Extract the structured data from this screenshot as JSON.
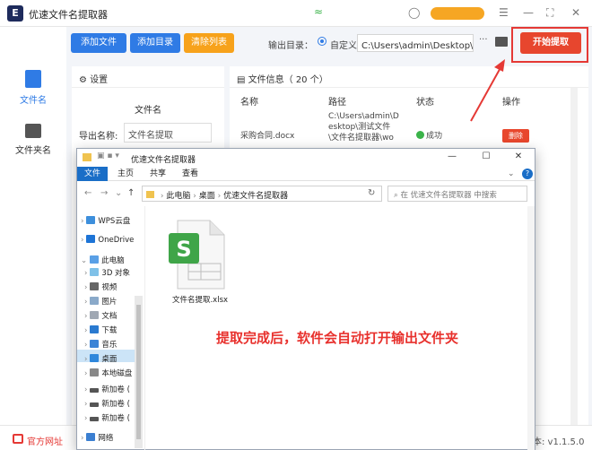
{
  "app": {
    "title": "优速文件名提取器",
    "logo": "E"
  },
  "sidebar": {
    "items": [
      {
        "label": "文件名",
        "icon": "file-icon",
        "color": "#2f7be5"
      },
      {
        "label": "文件夹名",
        "icon": "folder-icon",
        "color": "#555555"
      }
    ]
  },
  "toolbar": {
    "add_file": "添加文件",
    "add_dir": "添加目录",
    "clear_list": "清除列表",
    "output_label": "输出目录：",
    "custom_label": "自定义",
    "output_path": "C:\\Users\\admin\\Desktop\\优速",
    "more": "···",
    "start": "开始提取"
  },
  "settings": {
    "header": "设置",
    "column_title": "文件名",
    "export_label": "导出名称:",
    "export_value": "文件名提取"
  },
  "file_info": {
    "header": "文件信息（ 20 个）",
    "columns": [
      "名称",
      "路径",
      "状态",
      "操作"
    ],
    "row": {
      "name": "采购合同.docx",
      "path_lines": [
        "C:\\Users\\admin\\D",
        "esktop\\测试文件",
        "\\文件名提取器\\wo"
      ],
      "status": "成功",
      "action": "删除"
    }
  },
  "statusbar": {
    "home": "官方网址",
    "version": "本: v1.1.5.0"
  },
  "explorer": {
    "title": "优速文件名提取器",
    "tabs": [
      "文件",
      "主页",
      "共享",
      "查看"
    ],
    "breadcrumb": [
      "此电脑",
      "桌面",
      "优速文件名提取器"
    ],
    "search_placeholder": "在 优速文件名提取器 中搜索",
    "tree": [
      "WPS云盘",
      "OneDrive",
      "此电脑",
      "3D 对象",
      "视频",
      "图片",
      "文档",
      "下载",
      "音乐",
      "桌面",
      "本地磁盘",
      "新加卷 (",
      "新加卷 (",
      "新加卷 (",
      "网络"
    ],
    "file": {
      "name": "文件名提取.xlsx",
      "icon": "spreadsheet-icon",
      "badge": "S"
    }
  },
  "annotation": "提取完成后，软件会自动打开输出文件夹",
  "colors": {
    "primary": "#2f7be5",
    "orange": "#f7a21b",
    "danger": "#e7462e",
    "success": "#3bb34a",
    "annotation": "#e8312d"
  }
}
